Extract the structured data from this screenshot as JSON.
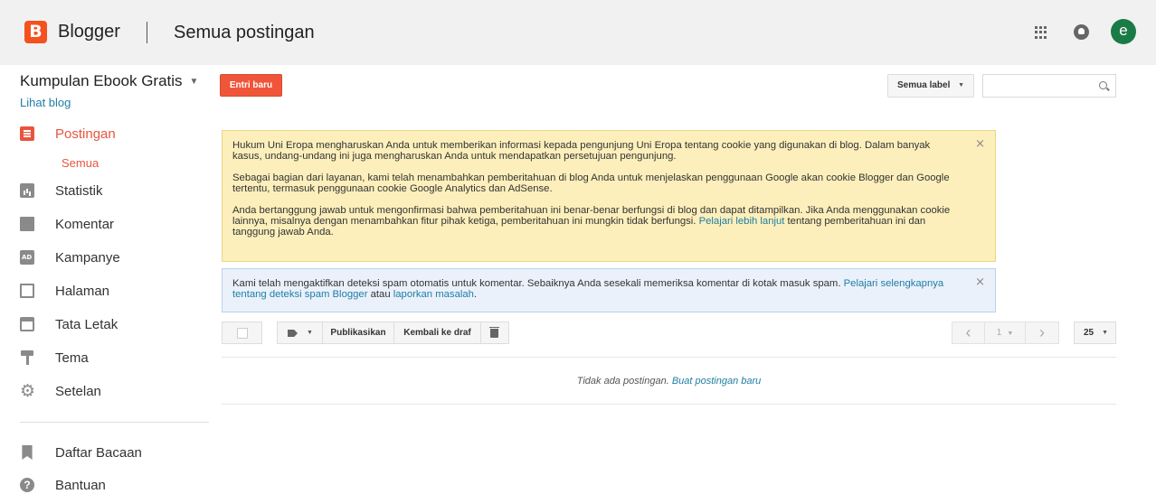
{
  "header": {
    "logo_letter": "B",
    "brand": "Blogger",
    "page_title": "Semua postingan",
    "avatar_letter": "e"
  },
  "sidebar": {
    "blog_name": "Kumpulan Ebook Gratis",
    "view_blog": "Lihat blog",
    "items": [
      {
        "label": "Postingan",
        "icon": "posts-icon",
        "active": true
      },
      {
        "label": "Statistik",
        "icon": "stats-icon"
      },
      {
        "label": "Komentar",
        "icon": "comments-icon"
      },
      {
        "label": "Kampanye",
        "icon": "campaign-icon"
      },
      {
        "label": "Halaman",
        "icon": "pages-icon"
      },
      {
        "label": "Tata Letak",
        "icon": "layout-icon"
      },
      {
        "label": "Tema",
        "icon": "theme-icon"
      },
      {
        "label": "Setelan",
        "icon": "gear-icon"
      }
    ],
    "sub_item": "Semua",
    "bottom_items": [
      {
        "label": "Daftar Bacaan",
        "icon": "bookmark-icon"
      },
      {
        "label": "Bantuan",
        "icon": "help-icon"
      }
    ]
  },
  "toolbar": {
    "new_post": "Entri baru",
    "label_filter": "Semua label",
    "search_placeholder": ""
  },
  "notices": {
    "cookie": {
      "p1": "Hukum Uni Eropa mengharuskan Anda untuk memberikan informasi kepada pengunjung Uni Eropa tentang cookie yang digunakan di blog. Dalam banyak kasus, undang-undang ini juga mengharuskan Anda untuk mendapatkan persetujuan pengunjung.",
      "p2": "Sebagai bagian dari layanan, kami telah menambahkan pemberitahuan di blog Anda untuk menjelaskan penggunaan Google akan cookie Blogger dan Google tertentu, termasuk penggunaan cookie Google Analytics dan AdSense.",
      "p3_before": "Anda bertanggung jawab untuk mengonfirmasi bahwa pemberitahuan ini benar-benar berfungsi di blog dan dapat ditampilkan. Jika Anda menggunakan cookie lainnya, misalnya dengan menambahkan fitur pihak ketiga, pemberitahuan ini mungkin tidak berfungsi.",
      "p3_link": "Pelajari lebih lanjut",
      "p3_after": "tentang pemberitahuan ini dan tanggung jawab Anda."
    },
    "spam": {
      "text": "Kami telah mengaktifkan deteksi spam otomatis untuk komentar. Sebaiknya Anda sesekali memeriksa komentar di kotak masuk spam.",
      "link1": "Pelajari selengkapnya tentang deteksi spam Blogger",
      "middle": "atau",
      "link2": "laporkan masalah",
      "end": "."
    },
    "close_glyph": "×"
  },
  "list_toolbar": {
    "publish": "Publikasikan",
    "revert_draft": "Kembali ke draf",
    "page": "1",
    "per_page": "25",
    "prev_glyph": "‹",
    "next_glyph": "›",
    "caret_glyph": "▼"
  },
  "empty": {
    "message": "Tidak ada postingan.",
    "link": "Buat postingan baru"
  }
}
